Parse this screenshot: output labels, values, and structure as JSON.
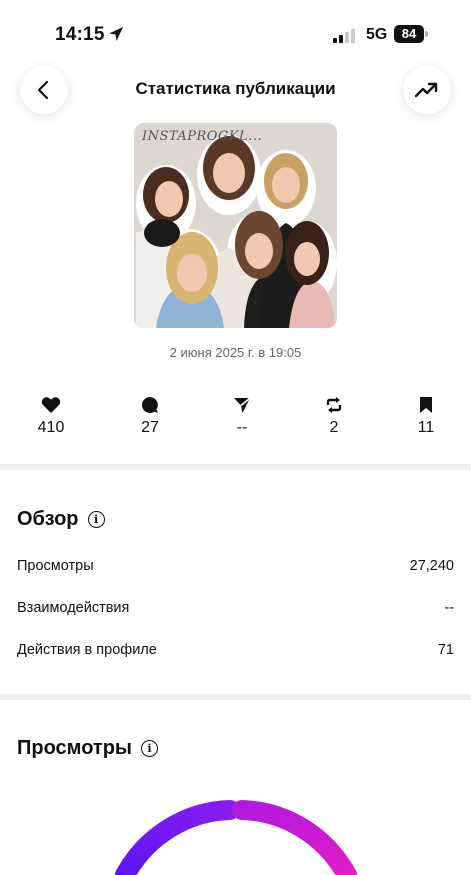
{
  "status_bar": {
    "time": "14:15",
    "network": "5G",
    "battery": "84"
  },
  "header": {
    "title": "Статистика публикации",
    "back_icon": "chevron-left-icon",
    "trend_icon": "trending-up-icon"
  },
  "post": {
    "thumbnail_caption": "INSTAPROGKL...",
    "date": "2 июня 2025 г. в 19:05"
  },
  "metrics": [
    {
      "icon": "heart-icon",
      "value": "410"
    },
    {
      "icon": "comment-icon",
      "value": "27"
    },
    {
      "icon": "send-icon",
      "value": "--"
    },
    {
      "icon": "repost-icon",
      "value": "2"
    },
    {
      "icon": "bookmark-icon",
      "value": "11"
    }
  ],
  "overview": {
    "title": "Обзор",
    "rows": [
      {
        "label": "Просмотры",
        "value": "27,240"
      },
      {
        "label": "Взаимодействия",
        "value": "--"
      },
      {
        "label": "Действия в профиле",
        "value": "71"
      }
    ]
  },
  "views": {
    "title": "Просмотры"
  },
  "colors": {
    "ring_start": "#6a1bf5",
    "ring_end": "#d31bd6",
    "divider": "#efeff2"
  }
}
